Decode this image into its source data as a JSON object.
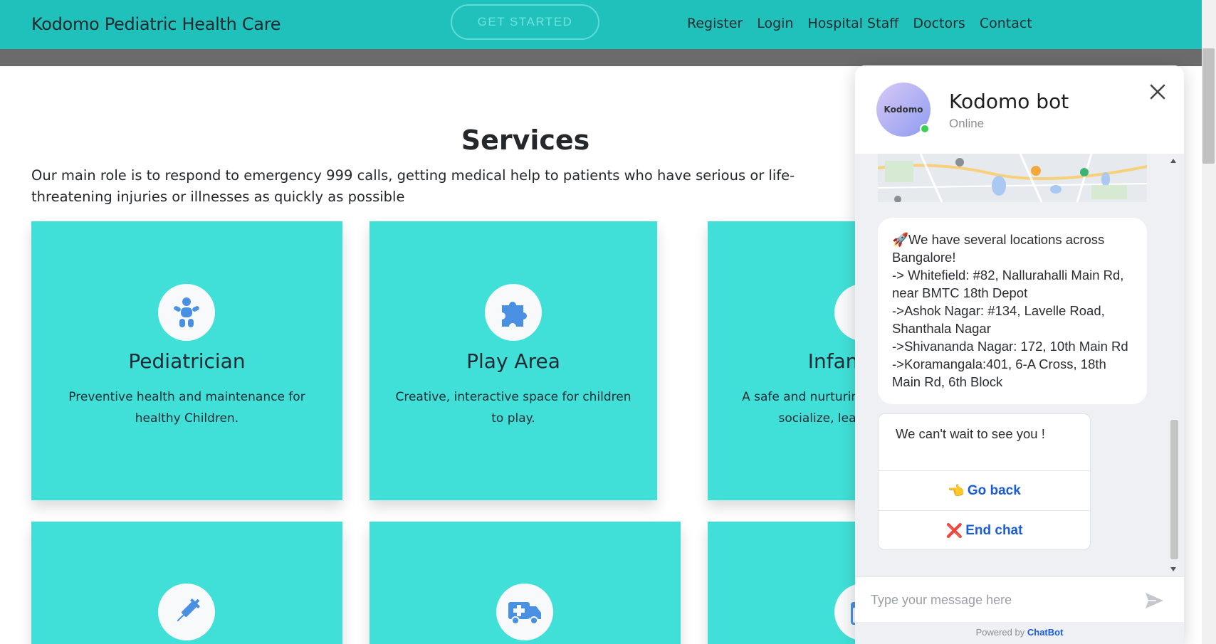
{
  "header": {
    "brand": "Kodomo Pediatric Health Care",
    "cta_label": "GET STARTED",
    "nav": [
      "Register",
      "Login",
      "Hospital Staff",
      "Doctors",
      "Contact"
    ]
  },
  "services": {
    "title": "Services",
    "description": "Our main role is to respond to emergency 999 calls, getting medical help to patients who have serious or life-threatening injuries or illnesses as quickly as possible",
    "cards": [
      {
        "title": "Pediatrician",
        "text": "Preventive health and maintenance for healthy Children.",
        "icon": "baby-icon"
      },
      {
        "title": "Play Area",
        "text": "Creative, interactive space for children to play.",
        "icon": "puzzle-icon"
      },
      {
        "title": "Infant Care",
        "text": "A safe and nurturing place for infants to socialize, learn and practice",
        "icon": "infant-icon"
      },
      {
        "title": "",
        "text": "",
        "icon": "syringe-icon"
      },
      {
        "title": "",
        "text": "",
        "icon": "ambulance-icon"
      },
      {
        "title": "",
        "text": "",
        "icon": "calendar-check-icon"
      }
    ]
  },
  "chat": {
    "bot_name": "Kodomo bot",
    "status": "Online",
    "avatar_text": "Kodomo",
    "message_lines": [
      "🚀We have several locations across",
      "Bangalore!",
      "-> Whitefield: #82, Nallurahalli Main Rd,",
      "near BMTC 18th Depot",
      "->Ashok Nagar: #134, Lavelle Road,",
      "Shanthala Nagar",
      "->Shivananda Nagar: 172, 10th Main Rd",
      "->Koramangala:401, 6-A Cross, 18th",
      "Main Rd, 6th Block"
    ],
    "quick_text": "We can't wait to see you !",
    "buttons": [
      {
        "emoji": "👈",
        "label": "Go back"
      },
      {
        "emoji": "❌",
        "label": "End chat"
      }
    ],
    "input_placeholder": "Type your message here",
    "powered_prefix": "Powered by",
    "powered_brand": "ChatBot"
  },
  "colors": {
    "header": "#20c1ba",
    "card": "#40e0d8",
    "icon_blue": "#4a90e2",
    "link": "#1a5dd6"
  }
}
